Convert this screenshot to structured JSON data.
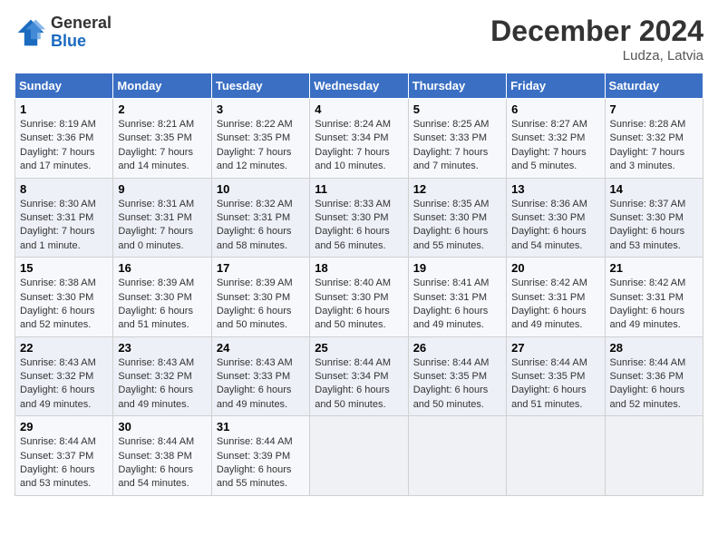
{
  "header": {
    "logo_general": "General",
    "logo_blue": "Blue",
    "month_year": "December 2024",
    "location": "Ludza, Latvia"
  },
  "weekdays": [
    "Sunday",
    "Monday",
    "Tuesday",
    "Wednesday",
    "Thursday",
    "Friday",
    "Saturday"
  ],
  "weeks": [
    [
      {
        "day": "1",
        "sunrise": "8:19 AM",
        "sunset": "3:36 PM",
        "daylight": "7 hours and 17 minutes."
      },
      {
        "day": "2",
        "sunrise": "8:21 AM",
        "sunset": "3:35 PM",
        "daylight": "7 hours and 14 minutes."
      },
      {
        "day": "3",
        "sunrise": "8:22 AM",
        "sunset": "3:35 PM",
        "daylight": "7 hours and 12 minutes."
      },
      {
        "day": "4",
        "sunrise": "8:24 AM",
        "sunset": "3:34 PM",
        "daylight": "7 hours and 10 minutes."
      },
      {
        "day": "5",
        "sunrise": "8:25 AM",
        "sunset": "3:33 PM",
        "daylight": "7 hours and 7 minutes."
      },
      {
        "day": "6",
        "sunrise": "8:27 AM",
        "sunset": "3:32 PM",
        "daylight": "7 hours and 5 minutes."
      },
      {
        "day": "7",
        "sunrise": "8:28 AM",
        "sunset": "3:32 PM",
        "daylight": "7 hours and 3 minutes."
      }
    ],
    [
      {
        "day": "8",
        "sunrise": "8:30 AM",
        "sunset": "3:31 PM",
        "daylight": "7 hours and 1 minute."
      },
      {
        "day": "9",
        "sunrise": "8:31 AM",
        "sunset": "3:31 PM",
        "daylight": "7 hours and 0 minutes."
      },
      {
        "day": "10",
        "sunrise": "8:32 AM",
        "sunset": "3:31 PM",
        "daylight": "6 hours and 58 minutes."
      },
      {
        "day": "11",
        "sunrise": "8:33 AM",
        "sunset": "3:30 PM",
        "daylight": "6 hours and 56 minutes."
      },
      {
        "day": "12",
        "sunrise": "8:35 AM",
        "sunset": "3:30 PM",
        "daylight": "6 hours and 55 minutes."
      },
      {
        "day": "13",
        "sunrise": "8:36 AM",
        "sunset": "3:30 PM",
        "daylight": "6 hours and 54 minutes."
      },
      {
        "day": "14",
        "sunrise": "8:37 AM",
        "sunset": "3:30 PM",
        "daylight": "6 hours and 53 minutes."
      }
    ],
    [
      {
        "day": "15",
        "sunrise": "8:38 AM",
        "sunset": "3:30 PM",
        "daylight": "6 hours and 52 minutes."
      },
      {
        "day": "16",
        "sunrise": "8:39 AM",
        "sunset": "3:30 PM",
        "daylight": "6 hours and 51 minutes."
      },
      {
        "day": "17",
        "sunrise": "8:39 AM",
        "sunset": "3:30 PM",
        "daylight": "6 hours and 50 minutes."
      },
      {
        "day": "18",
        "sunrise": "8:40 AM",
        "sunset": "3:30 PM",
        "daylight": "6 hours and 50 minutes."
      },
      {
        "day": "19",
        "sunrise": "8:41 AM",
        "sunset": "3:31 PM",
        "daylight": "6 hours and 49 minutes."
      },
      {
        "day": "20",
        "sunrise": "8:42 AM",
        "sunset": "3:31 PM",
        "daylight": "6 hours and 49 minutes."
      },
      {
        "day": "21",
        "sunrise": "8:42 AM",
        "sunset": "3:31 PM",
        "daylight": "6 hours and 49 minutes."
      }
    ],
    [
      {
        "day": "22",
        "sunrise": "8:43 AM",
        "sunset": "3:32 PM",
        "daylight": "6 hours and 49 minutes."
      },
      {
        "day": "23",
        "sunrise": "8:43 AM",
        "sunset": "3:32 PM",
        "daylight": "6 hours and 49 minutes."
      },
      {
        "day": "24",
        "sunrise": "8:43 AM",
        "sunset": "3:33 PM",
        "daylight": "6 hours and 49 minutes."
      },
      {
        "day": "25",
        "sunrise": "8:44 AM",
        "sunset": "3:34 PM",
        "daylight": "6 hours and 50 minutes."
      },
      {
        "day": "26",
        "sunrise": "8:44 AM",
        "sunset": "3:35 PM",
        "daylight": "6 hours and 50 minutes."
      },
      {
        "day": "27",
        "sunrise": "8:44 AM",
        "sunset": "3:35 PM",
        "daylight": "6 hours and 51 minutes."
      },
      {
        "day": "28",
        "sunrise": "8:44 AM",
        "sunset": "3:36 PM",
        "daylight": "6 hours and 52 minutes."
      }
    ],
    [
      {
        "day": "29",
        "sunrise": "8:44 AM",
        "sunset": "3:37 PM",
        "daylight": "6 hours and 53 minutes."
      },
      {
        "day": "30",
        "sunrise": "8:44 AM",
        "sunset": "3:38 PM",
        "daylight": "6 hours and 54 minutes."
      },
      {
        "day": "31",
        "sunrise": "8:44 AM",
        "sunset": "3:39 PM",
        "daylight": "6 hours and 55 minutes."
      },
      null,
      null,
      null,
      null
    ]
  ]
}
